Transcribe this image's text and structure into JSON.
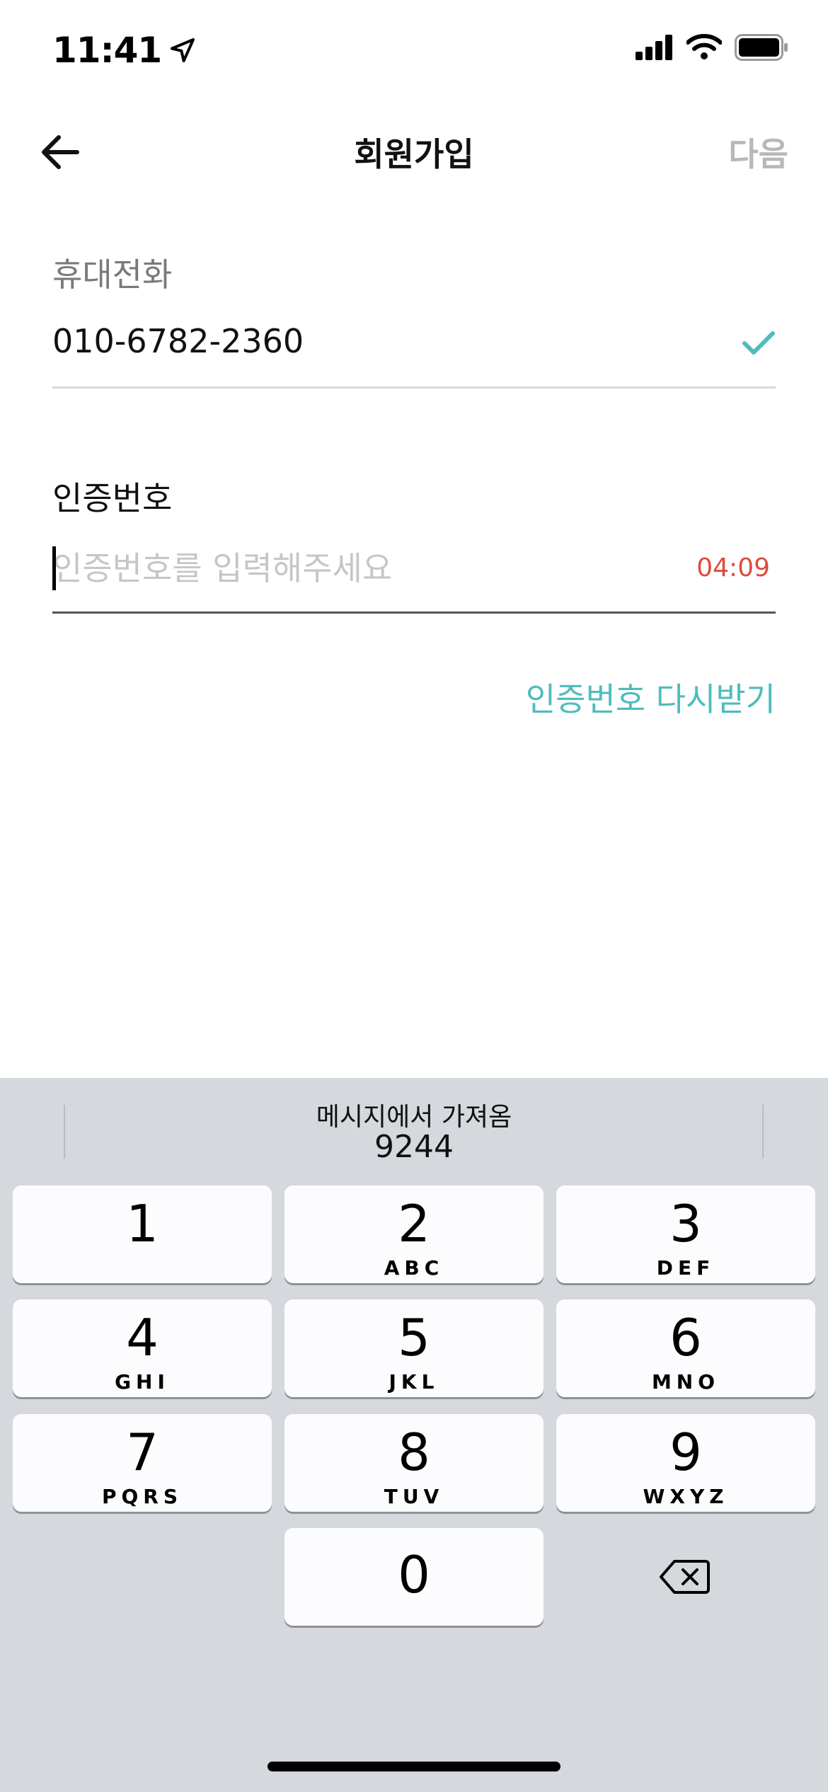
{
  "status_bar": {
    "time": "11:41",
    "icons": [
      "location-arrow-icon",
      "cellular-signal-icon",
      "wifi-icon",
      "battery-icon"
    ]
  },
  "nav": {
    "back_icon": "arrow-left-icon",
    "title": "회원가입",
    "next_label": "다음"
  },
  "phone": {
    "label": "휴대전화",
    "value": "010-6782-2360",
    "status_icon": "checkmark-icon"
  },
  "code": {
    "label": "인증번호",
    "placeholder": "인증번호를 입력해주세요",
    "value": "",
    "timer": "04:09"
  },
  "resend_label": "인증번호 다시받기",
  "keyboard": {
    "suggestion_source": "메시지에서 가져옴",
    "suggestion_code": "9244",
    "keys": [
      {
        "digit": "1",
        "letters": ""
      },
      {
        "digit": "2",
        "letters": "ABC"
      },
      {
        "digit": "3",
        "letters": "DEF"
      },
      {
        "digit": "4",
        "letters": "GHI"
      },
      {
        "digit": "5",
        "letters": "JKL"
      },
      {
        "digit": "6",
        "letters": "MNO"
      },
      {
        "digit": "7",
        "letters": "PQRS"
      },
      {
        "digit": "8",
        "letters": "TUV"
      },
      {
        "digit": "9",
        "letters": "WXYZ"
      },
      {
        "digit": "0",
        "letters": ""
      }
    ],
    "backspace_icon": "backspace-icon"
  },
  "colors": {
    "accent": "#4fbcbc",
    "timer": "#e04a3a",
    "disabled": "#b8b8b8",
    "keyboard_bg": "#d5d8dd"
  }
}
